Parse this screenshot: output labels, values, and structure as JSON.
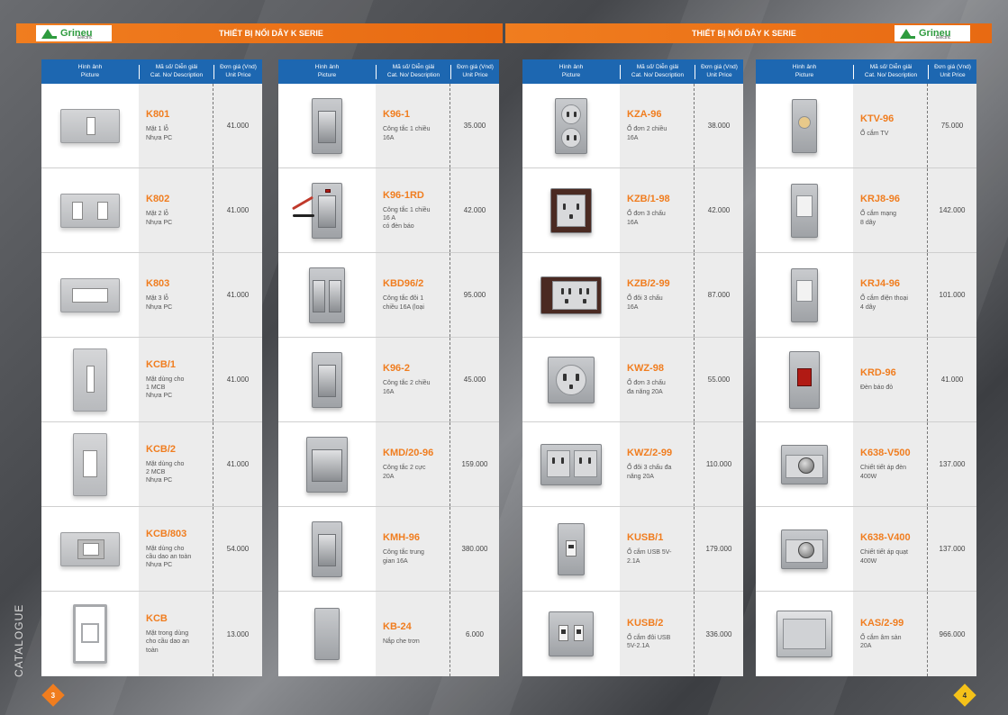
{
  "header": {
    "left_title": "THIẾT BỊ NỐI DÂY K SERIE",
    "right_title": "THIẾT BỊ NỐI DÂY K SERIE",
    "brand": "Grineu",
    "brand_sub": "Electric"
  },
  "table_header": {
    "picture_vi": "Hình ảnh",
    "picture_en": "Picture",
    "desc_vi": "Mã số/ Diễn giải",
    "desc_en": "Cat. No/ Description",
    "price_vi": "Đơn giá (Vnd)",
    "price_en": "Unit Price"
  },
  "columns": [
    {
      "products": [
        {
          "code": "K801",
          "desc": "Mặt 1 lỗ\nNhựa PC",
          "price": "41.000",
          "kind": "plate1"
        },
        {
          "code": "K802",
          "desc": "Mặt 2 lỗ\nNhựa PC",
          "price": "41.000",
          "kind": "plate2"
        },
        {
          "code": "K803",
          "desc": "Mặt 3 lỗ\nNhựa PC",
          "price": "41.000",
          "kind": "plate3"
        },
        {
          "code": "KCB/1",
          "desc": "Mặt dùng cho\n1 MCB\n Nhựa PC",
          "price": "41.000",
          "kind": "vplate1"
        },
        {
          "code": "KCB/2",
          "desc": "Mặt dùng cho\n2 MCB\nNhựa PC",
          "price": "41.000",
          "kind": "vplate2"
        },
        {
          "code": "KCB/803",
          "desc": "Mặt dùng cho\ncầu dao an toàn\nNhựa PC",
          "price": "54.000",
          "kind": "plate803"
        },
        {
          "code": "KCB",
          "desc": "Mặt trong dùng\ncho cầu dao an\ntoàn",
          "price": "13.000",
          "kind": "frame"
        }
      ]
    },
    {
      "products": [
        {
          "code": "K96-1",
          "desc": "Công tắc 1 chiều\n16A",
          "price": "35.000",
          "kind": "switch"
        },
        {
          "code": "K96-1RD",
          "desc": "Công tắc 1 chiều\n16 A\ncó đèn báo",
          "price": "42.000",
          "kind": "switchwire"
        },
        {
          "code": "KBD96/2",
          "desc": "Công tắc đôi 1\nchiều 16A (loại",
          "price": "95.000",
          "kind": "switchdouble"
        },
        {
          "code": "K96-2",
          "desc": "Công tắc 2 chiều\n16A",
          "price": "45.000",
          "kind": "switch"
        },
        {
          "code": "KMD/20-96",
          "desc": "Công tắc 2 cực\n20A",
          "price": "159.000",
          "kind": "switchwide"
        },
        {
          "code": "KMH-96",
          "desc": "Công tắc trung\ngian 16A",
          "price": "380.000",
          "kind": "switch"
        },
        {
          "code": "KB-24",
          "desc": "Nắp che trơn",
          "price": "6.000",
          "kind": "blank"
        }
      ]
    },
    {
      "products": [
        {
          "code": "KZA-96",
          "desc": "Ổ đơn 2 chiều\n16A",
          "price": "38.000",
          "kind": "socket2"
        },
        {
          "code": "KZB/1-98",
          "desc": "Ổ đơn 3 chấu\n16A",
          "price": "42.000",
          "kind": "socket3dark"
        },
        {
          "code": "KZB/2-99",
          "desc": "Ổ đôi 3 chấu\n16A",
          "price": "87.000",
          "kind": "socketdoubledark"
        },
        {
          "code": "KWZ-98",
          "desc": "Ổ đơn 3 chấu\nđa năng 20A",
          "price": "55.000",
          "kind": "socketmulti"
        },
        {
          "code": "KWZ/2-99",
          "desc": "Ổ đôi 3 chấu đa\nnăng 20A",
          "price": "110.000",
          "kind": "socketmultidouble"
        },
        {
          "code": "KUSB/1",
          "desc": "Ổ cắm USB 5V-\n2.1A",
          "price": "179.000",
          "kind": "usb1"
        },
        {
          "code": "KUSB/2",
          "desc": "Ổ cắm đôi USB\n5V-2.1A",
          "price": "336.000",
          "kind": "usb2"
        }
      ]
    },
    {
      "products": [
        {
          "code": "KTV-96",
          "desc": "Ổ cắm TV",
          "price": "75.000",
          "kind": "tv"
        },
        {
          "code": "KRJ8-96",
          "desc": "Ổ cắm mạng\n8 dây",
          "price": "142.000",
          "kind": "rj"
        },
        {
          "code": "KRJ4-96",
          "desc": "Ổ cắm điện thoại\n4 dây",
          "price": "101.000",
          "kind": "rj"
        },
        {
          "code": "KRD-96",
          "desc": "Đèn báo đỏ",
          "price": "41.000",
          "kind": "red"
        },
        {
          "code": "K638-V500",
          "desc": "Chiết tiết áp đèn\n400W",
          "price": "137.000",
          "kind": "dimmer"
        },
        {
          "code": "K638-V400",
          "desc": "Chiết tiết áp quạt\n400W",
          "price": "137.000",
          "kind": "dimmer"
        },
        {
          "code": "KAS/2-99",
          "desc": "Ổ cắm âm sàn\n20A",
          "price": "966.000",
          "kind": "floor"
        }
      ]
    }
  ],
  "footer": {
    "catalogue": "CATALOGUE",
    "page_left": "3",
    "page_right": "4"
  }
}
